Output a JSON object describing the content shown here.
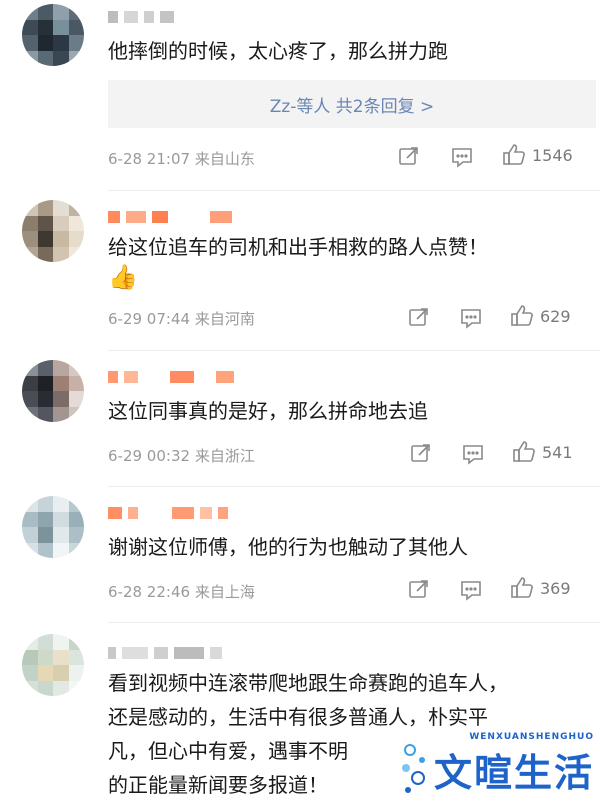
{
  "comments": [
    {
      "text_lines": [
        "他摔倒的时候，太心疼了，那么拼力跑"
      ],
      "replies": "Zz-等人  共2条回复 >",
      "date": "6-28 21:07",
      "location": "来自山东",
      "likes": "1546"
    },
    {
      "text_lines": [
        "给这位追车的司机和出手相救的路人点赞！"
      ],
      "emoji": "👍",
      "date": "6-29 07:44",
      "location": "来自河南",
      "likes": "629"
    },
    {
      "text_lines": [
        "这位同事真的是好，那么拼命地去追"
      ],
      "date": "6-29 00:32",
      "location": "来自浙江",
      "likes": "541"
    },
    {
      "text_lines": [
        "谢谢这位师傅，他的行为也触动了其他人"
      ],
      "date": "6-28 22:46",
      "location": "来自上海",
      "likes": "369"
    },
    {
      "text_lines": [
        "看到视频中连滚带爬地跟生命赛跑的追车人，",
        "还是感动的，生活中有很多普通人，朴实平",
        "凡，但心中有爱，遇事不明",
        "的正能量新闻要多报道！"
      ]
    }
  ],
  "watermark": {
    "top_text": "WENXUANSHENGHUO",
    "main_text": "文暄生活"
  },
  "colors": {
    "reply_link": "#6b86b5",
    "meta_gray": "#9a9a9a",
    "watermark_blue": "#1e63c9"
  },
  "icons": [
    "share-icon",
    "comment-icon",
    "like-icon"
  ]
}
